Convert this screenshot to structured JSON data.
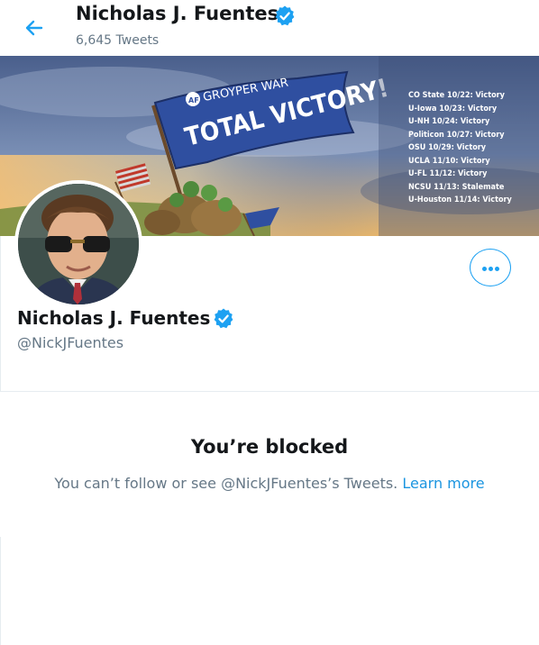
{
  "header": {
    "name": "Nicholas J. Fuentes",
    "tweet_count": "6,645 Tweets"
  },
  "banner": {
    "flag_top": "GROYPER WAR",
    "flag_main": "TOTAL VICTORY!",
    "flag_logo": "AF",
    "results": [
      "CO State 10/22: Victory",
      "U-Iowa 10/23: Victory",
      "U-NH 10/24: Victory",
      "Politicon 10/27: Victory",
      "OSU 10/29: Victory",
      "UCLA 11/10: Victory",
      "U-FL 11/12: Victory",
      "NCSU 11/13: Stalemate",
      "U-Houston 11/14: Victory"
    ]
  },
  "profile": {
    "name": "Nicholas J. Fuentes",
    "handle": "@NickJFuentes"
  },
  "blocked": {
    "title": "You’re blocked",
    "message": "You can’t follow or see @NickJFuentes’s Tweets.",
    "link": "Learn more"
  },
  "colors": {
    "accent": "#1da1f2",
    "secondary_text": "#657786",
    "primary_text": "#14171a"
  }
}
